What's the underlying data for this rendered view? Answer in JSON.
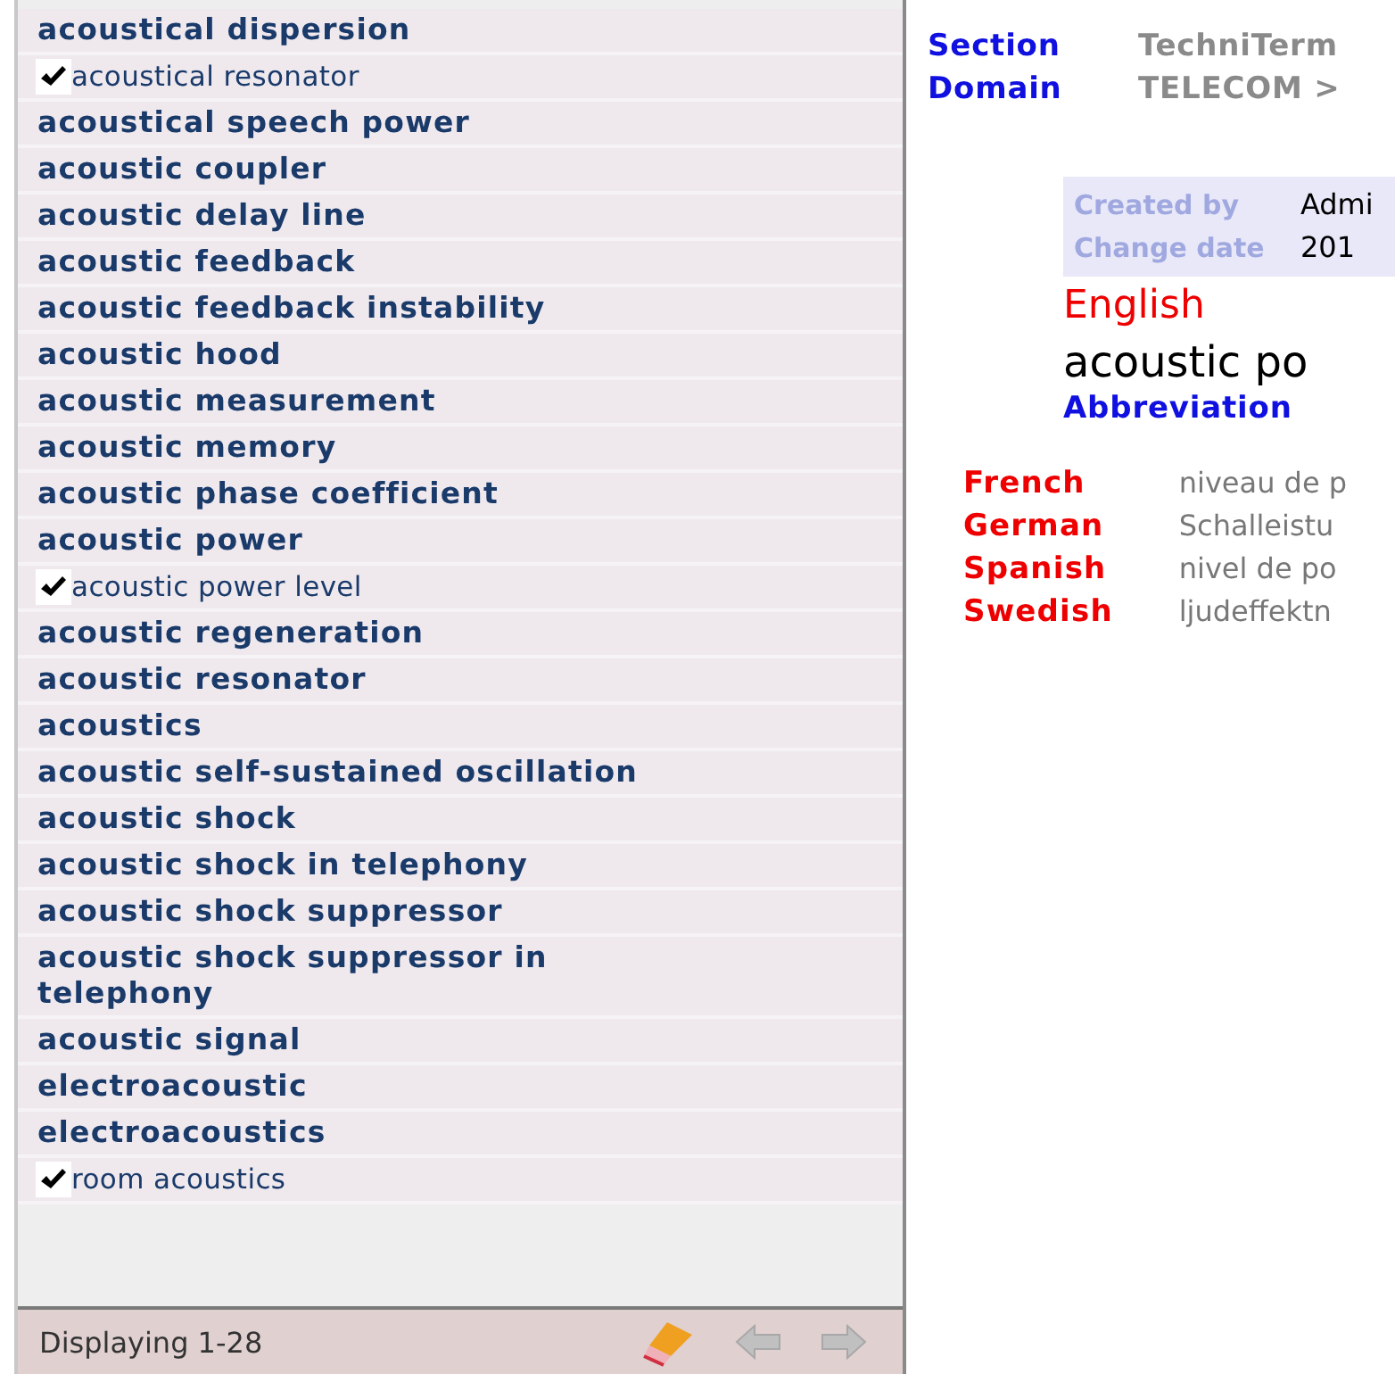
{
  "term_list": {
    "items": [
      {
        "label": "acoustical dispersion",
        "checked": false
      },
      {
        "label": "acoustical resonator",
        "checked": true
      },
      {
        "label": "acoustical speech power",
        "checked": false
      },
      {
        "label": "acoustic coupler",
        "checked": false
      },
      {
        "label": "acoustic delay line",
        "checked": false
      },
      {
        "label": "acoustic feedback",
        "checked": false
      },
      {
        "label": "acoustic feedback instability",
        "checked": false
      },
      {
        "label": "acoustic hood",
        "checked": false
      },
      {
        "label": "acoustic measurement",
        "checked": false
      },
      {
        "label": "acoustic memory",
        "checked": false
      },
      {
        "label": "acoustic phase coefficient",
        "checked": false
      },
      {
        "label": "acoustic power",
        "checked": false
      },
      {
        "label": "acoustic power level",
        "checked": true
      },
      {
        "label": "acoustic regeneration",
        "checked": false
      },
      {
        "label": "acoustic resonator",
        "checked": false
      },
      {
        "label": "acoustics",
        "checked": false
      },
      {
        "label": "acoustic self-sustained oscillation",
        "checked": false
      },
      {
        "label": "acoustic shock",
        "checked": false
      },
      {
        "label": "acoustic shock in telephony",
        "checked": false
      },
      {
        "label": "acoustic shock suppressor",
        "checked": false
      },
      {
        "label": "acoustic shock suppressor in telephony",
        "checked": false
      },
      {
        "label": "acoustic signal",
        "checked": false
      },
      {
        "label": "electroacoustic",
        "checked": false
      },
      {
        "label": "electroacoustics",
        "checked": false
      },
      {
        "label": "room acoustics",
        "checked": true
      }
    ],
    "footer": {
      "status": "Displaying 1-28"
    }
  },
  "detail": {
    "header": [
      {
        "label": "Section",
        "value": "TechniTerm"
      },
      {
        "label": "Domain",
        "value": "TELECOM >"
      }
    ],
    "meta": [
      {
        "label": "Created by",
        "value": "Admi"
      },
      {
        "label": "Change date",
        "value": "201"
      }
    ],
    "language": "English",
    "term": "acoustic po",
    "abbreviation_label": "Abbreviation",
    "translations": [
      {
        "language": "French",
        "term": "niveau de p"
      },
      {
        "language": "German",
        "term": "Schalleistu"
      },
      {
        "language": "Spanish",
        "term": "nivel de po"
      },
      {
        "language": "Swedish",
        "term": "ljudeffektn"
      }
    ]
  }
}
